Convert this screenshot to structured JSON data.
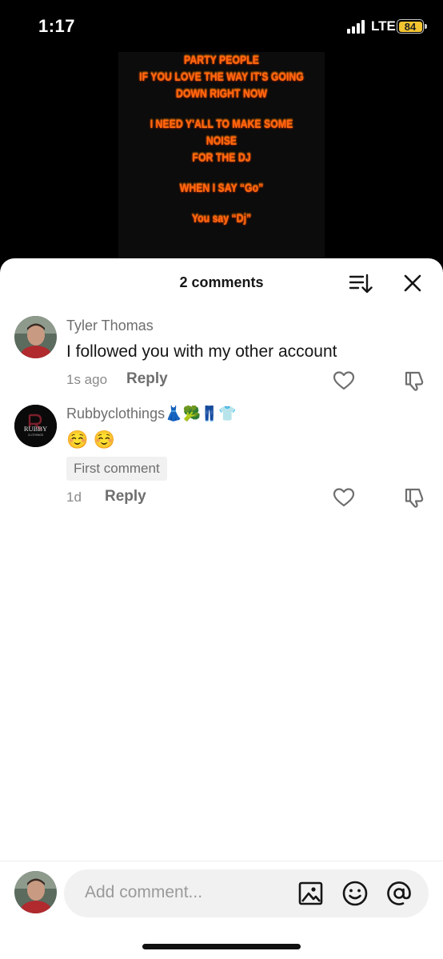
{
  "status_bar": {
    "time": "1:17",
    "network": "LTE",
    "battery": "84"
  },
  "video": {
    "lines": [
      "PARTY PEOPLE",
      "IF YOU LOVE THE WAY IT'S GOING",
      "DOWN RIGHT NOW",
      "",
      "I NEED Y'ALL TO MAKE SOME NOISE",
      "FOR THE DJ",
      "",
      "WHEN I SAY “Go”",
      "",
      "You say “Dj”"
    ]
  },
  "sheet": {
    "title": "2 comments"
  },
  "comments": [
    {
      "author": "Tyler Thomas",
      "text": "I followed you with my other account",
      "time": "1s ago",
      "reply_label": "Reply"
    },
    {
      "author": "Rubbyclothings👗🥦👖👕",
      "avatar_text": "RUBBY",
      "avatar_subtext": "CLOTHINGS",
      "text": "☺️ ☺️",
      "badge": "First comment",
      "time": "1d",
      "reply_label": "Reply"
    }
  ],
  "composer": {
    "placeholder": "Add comment..."
  },
  "colors": {
    "accent_text": "#161616",
    "muted": "#6e6e6e",
    "fire": "#ff6a10",
    "battery": "#f4c430"
  },
  "icons": [
    "sort-icon",
    "close-icon",
    "heart-icon",
    "dislike-icon",
    "image-icon",
    "emoji-icon",
    "mention-icon"
  ]
}
